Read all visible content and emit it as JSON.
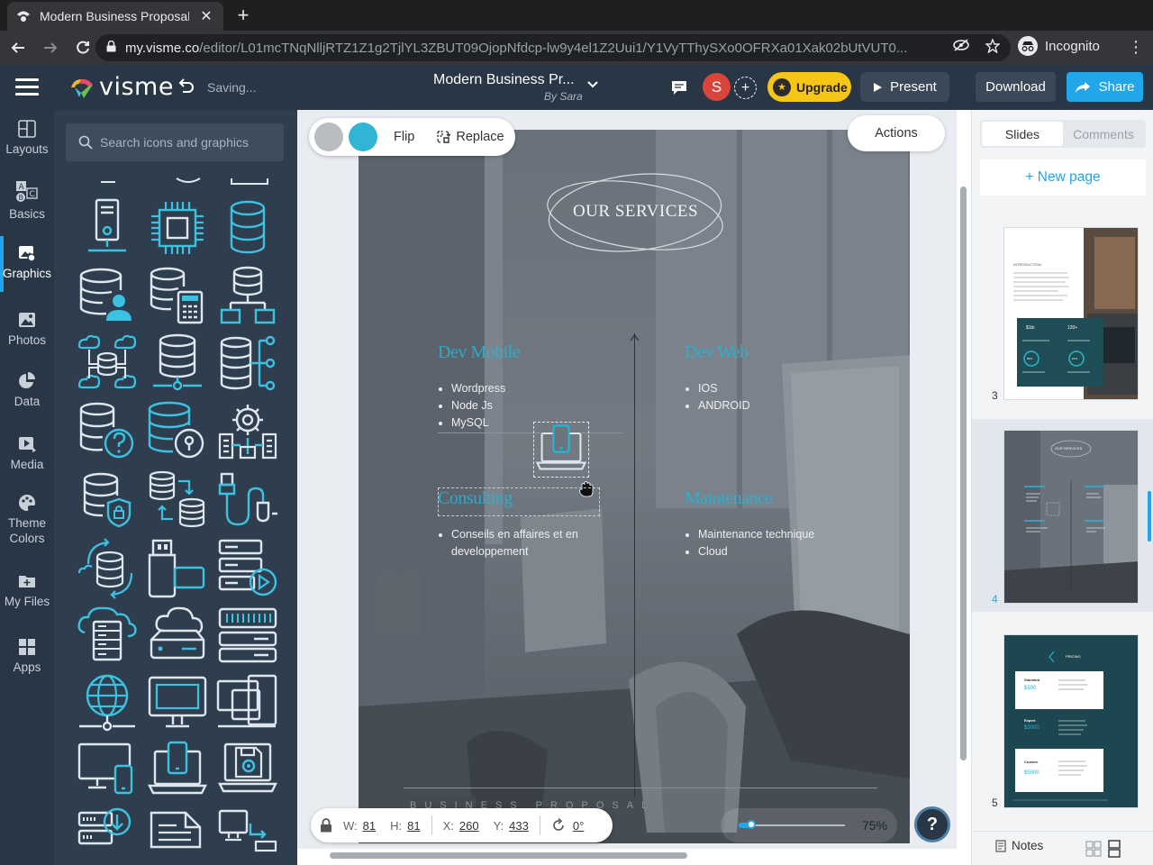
{
  "browser": {
    "tab_title": "Modern Business Proposal",
    "url_domain": "my.visme.co",
    "url_path": "/editor/L01mcTNqNlljRTZ1Z1g2TjlYL3ZBUT09OjopNfdcp-lw9y4el1Z2Uui1/Y1VyTThySXo0OFRXa01Xak02bUtVUT0...",
    "incognito_label": "Incognito"
  },
  "header": {
    "logo_text": "visme",
    "status": "Saving...",
    "doc_title": "Modern Business Pr...",
    "doc_author": "By Sara",
    "avatar_initial": "S",
    "upgrade_label": "Upgrade",
    "present_label": "Present",
    "download_label": "Download",
    "share_label": "Share"
  },
  "rail": {
    "items": [
      {
        "label1": "Layouts",
        "label2": ""
      },
      {
        "label1": "Basics",
        "label2": ""
      },
      {
        "label1": "Graphics",
        "label2": ""
      },
      {
        "label1": "Photos",
        "label2": ""
      },
      {
        "label1": "Data",
        "label2": ""
      },
      {
        "label1": "Media",
        "label2": ""
      },
      {
        "label1": "Theme",
        "label2": "Colors"
      },
      {
        "label1": "My Files",
        "label2": ""
      },
      {
        "label1": "Apps",
        "label2": ""
      }
    ]
  },
  "panel": {
    "search_placeholder": "Search icons and graphics"
  },
  "toolbar": {
    "swatch_colors": [
      "#b9bcc1",
      "#30b5d4"
    ],
    "flip_label": "Flip",
    "replace_label": "Replace",
    "actions_label": "Actions"
  },
  "slide": {
    "heading": "OUR SERVICES",
    "footer_text": "BUSINESS PROPOSAL",
    "sections": [
      {
        "title": "Dev Mobile",
        "items": [
          "Wordpress",
          "Node Js",
          "MySQL"
        ]
      },
      {
        "title": "Dev Web",
        "items": [
          "IOS",
          "ANDROID"
        ]
      },
      {
        "title": "Consulting",
        "items": [
          "Conseils en affaires et en developpement"
        ]
      },
      {
        "title": "Maintenance",
        "items": [
          "Maintenance technique",
          "Cloud"
        ]
      }
    ],
    "accent": "#21b8d9"
  },
  "props": {
    "w_label": "W:",
    "w": "81",
    "h_label": "H:",
    "h": "81",
    "x_label": "X:",
    "x": "260",
    "y_label": "Y:",
    "y": "433",
    "rotation": "0°",
    "zoom": "75%",
    "zoom_level": 0.12
  },
  "help_label": "?",
  "right_panel": {
    "tab_slides": "Slides",
    "tab_comments": "Comments",
    "new_page": "+ New page",
    "pages": [
      {
        "number": "3",
        "intro_title": "INTRODUCTION",
        "stat1": "$1bi",
        "stat2": "120+",
        "pct1": "80%",
        "pct2": "91%"
      },
      {
        "number": "4",
        "heading": "OUR SERVICES"
      },
      {
        "number": "5",
        "heading": "PRICING",
        "plans": [
          {
            "name": "Standard",
            "price": "$500"
          },
          {
            "name": "Expert",
            "price": "$3000"
          },
          {
            "name": "Custom",
            "price": "$5000"
          }
        ]
      }
    ],
    "notes_label": "Notes"
  }
}
